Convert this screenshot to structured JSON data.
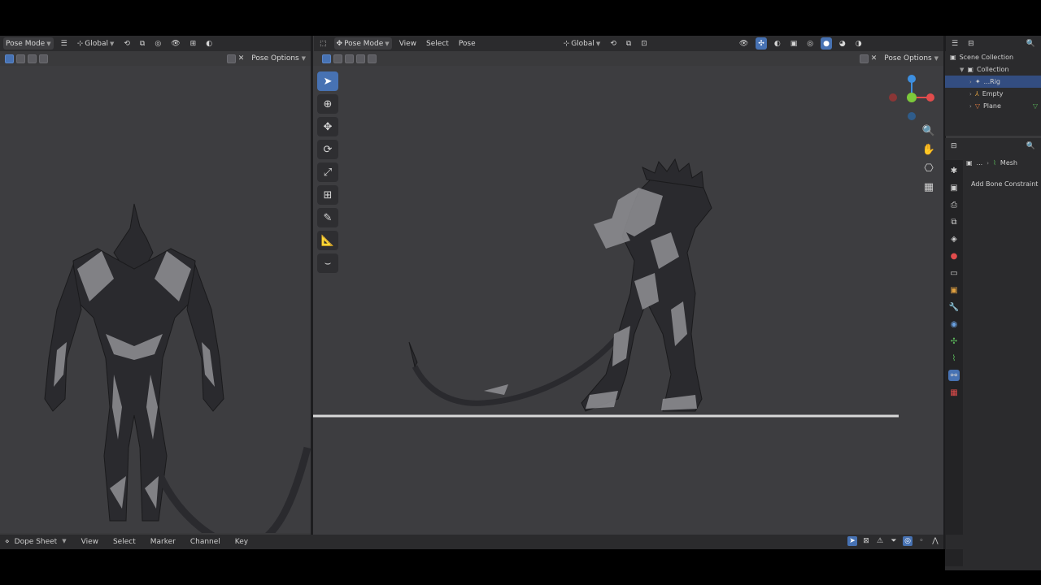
{
  "left_viewport": {
    "mode": "Pose Mode",
    "orientation": "Global",
    "pose_options": "Pose Options"
  },
  "main_viewport": {
    "mode": "Pose Mode",
    "menu": [
      "View",
      "Select",
      "Pose"
    ],
    "orientation": "Global",
    "pose_options": "Pose Options"
  },
  "outliner": {
    "root": "Scene Collection",
    "collection": "Collection",
    "items": [
      {
        "label": "...Rig",
        "selected": true
      },
      {
        "label": "Empty",
        "selected": false
      },
      {
        "label": "Plane",
        "selected": false
      }
    ]
  },
  "properties": {
    "breadcrumb_sep": "...",
    "breadcrumb_item": "Mesh",
    "add_constraint": "Add Bone Constraint"
  },
  "dope_sheet": {
    "editor": "Dope Sheet",
    "menu": [
      "View",
      "Select",
      "Marker",
      "Channel",
      "Key"
    ]
  },
  "colors": {
    "accent": "#4772b3",
    "gizmo_x": "#e24c4c",
    "gizmo_y": "#7cc93b",
    "gizmo_z": "#3d8fe0"
  }
}
